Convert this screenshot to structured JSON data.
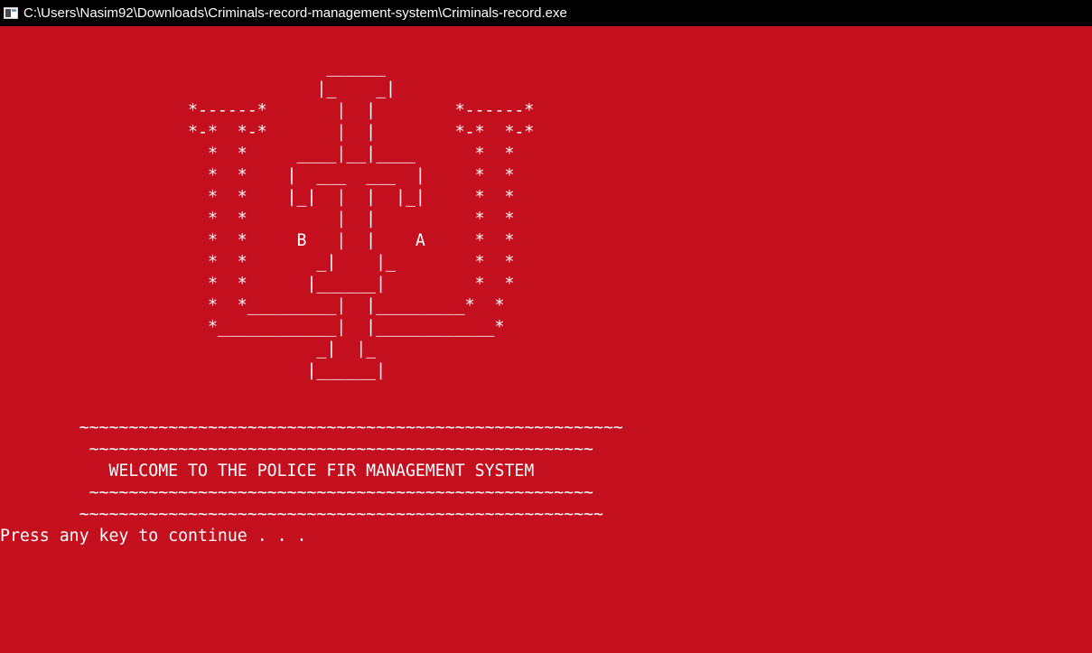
{
  "window": {
    "title": "C:\\Users\\Nasim92\\Downloads\\Criminals-record-management-system\\Criminals-record.exe",
    "background_color": "#c40f1e",
    "text_color": "#ffffff",
    "titlebar_color": "#000000",
    "icon": "console-app-icon"
  },
  "console": {
    "emblem_art": "                                 ______\n                                |_    _|\n                   *------*       |  |        *------*\n                   *-*  *-*       |  |        *-*  *-*\n                     *  *     ____|__|____      *  *\n                     *  *    |  ___  ___  |     *  *\n                     *  *    |_|  |  |  |_|     *  *\n                     *  *         |  |          *  *\n                     *  *     B   |  |    A     *  *\n                     *  *       _|    |_        *  *\n                     *  *      |______|         *  *\n                     *  *_________|  |_________*  *\n                     *____________|  |____________*\n                                _|  |_\n                               |______|",
    "line_wave_1": "        ~~~~~~~~~~~~~~~~~~~~~~~~~~~~~~~~~~~~~~~~~~~~~~~~~~~~~~~",
    "line_wave_2": "         ~~~~~~~~~~~~~~~~~~~~~~~~~~~~~~~~~~~~~~~~~~~~~~~~~~~",
    "welcome": "           WELCOME TO THE POLICE FIR MANAGEMENT SYSTEM",
    "line_wave_3": "         ~~~~~~~~~~~~~~~~~~~~~~~~~~~~~~~~~~~~~~~~~~~~~~~~~~~",
    "line_wave_4": "        ~~~~~~~~~~~~~~~~~~~~~~~~~~~~~~~~~~~~~~~~~~~~~~~~~~~~~",
    "prompt": "Press any key to continue . . ."
  }
}
